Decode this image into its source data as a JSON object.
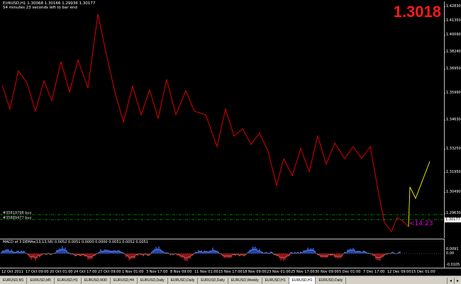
{
  "chart": {
    "symbol_line": "EURUSD,H1  1.30068 1.30166 1.29936 1.30177",
    "countdown_note": "54 minutes 23 seconds left to bar end",
    "current_price_big": "1.3018",
    "current_price_tag": "1.30177",
    "countdown_timer": "<14:23",
    "price_ticks": [
      "1.42830",
      "1.41350",
      "1.40090",
      "1.38240",
      "1.36950",
      "1.35990",
      "1.34630",
      "1.33250",
      "1.31950",
      "1.30490",
      "1.29630"
    ],
    "orders": [
      "#35819798 buy",
      "#35889477 buy"
    ],
    "colors": {
      "price_line": "#e00000",
      "projection_line": "#e6e600",
      "order_line": "#00b000",
      "countdown": "#e000e0",
      "macd_up": "#3366ff",
      "macd_down": "#e02020",
      "macd_signal": "#c0c0c0"
    }
  },
  "macd": {
    "label": "MACD of 3 DEMAs(13,13,58) 0.0052 0.0051 0.0000 0.0000 0.0051 0.0052 0.0051",
    "ticks": [
      "0.0091",
      "0.00",
      "-0.0105"
    ]
  },
  "time_axis": [
    "12 Oct 2011",
    "17 Oct 09:00",
    "20 Oct 01:00",
    "24 Oct 17:00",
    "27 Oct 09:00",
    "1 Nov 01:00",
    "3 Nov 17:00",
    "8 Nov 09:00",
    "11 Nov 01:00",
    "15 Nov 17:00",
    "18 Nov 09:00",
    "23 Nov 01:00",
    "25 Nov 17:00",
    "30 Nov 09:00",
    "5 Dec 01:00",
    "7 Dec 17:00",
    "12 Dec 09:00",
    "15 Dec 01:00"
  ],
  "tabs": [
    {
      "label": "EURUSD,M1",
      "active": false
    },
    {
      "label": "EURUSD,M5",
      "active": false
    },
    {
      "label": "EURUSD,H1",
      "active": false
    },
    {
      "label": "EURUSD,M30",
      "active": false
    },
    {
      "label": "EURUSD,H4",
      "active": false
    },
    {
      "label": "EURUSD,Daily",
      "active": false
    },
    {
      "label": "EURUSD,Daily",
      "active": false
    },
    {
      "label": "EURUSD,Daily",
      "active": false
    },
    {
      "label": "EURUSD,Weekly",
      "active": false
    },
    {
      "label": "EURUSD,H1",
      "active": false
    },
    {
      "label": "EURUSD,H1",
      "active": true
    },
    {
      "label": "EURUSD,Daily",
      "active": false
    }
  ],
  "tab_arrows": [
    "◂",
    "▸"
  ]
}
